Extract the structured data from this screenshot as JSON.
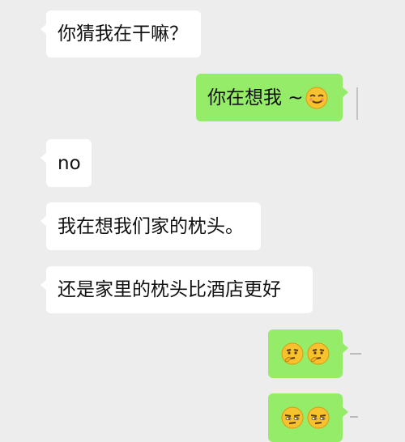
{
  "chat": {
    "messages": [
      {
        "side": "incoming",
        "text": "你猜我在干嘛？"
      },
      {
        "side": "outgoing",
        "text": "你在想我 ~",
        "emojis": [
          "smirk-face-emoji"
        ]
      },
      {
        "side": "incoming",
        "text": "no"
      },
      {
        "side": "incoming",
        "text": "我在想我们家的枕头。"
      },
      {
        "side": "incoming",
        "text": "还是家里的枕头比酒店更好"
      },
      {
        "side": "outgoing",
        "text": "",
        "emojis": [
          "thinking-face-emoji",
          "thinking-face-emoji"
        ]
      },
      {
        "side": "outgoing",
        "text": "",
        "emojis": [
          "skeptical-face-emoji",
          "skeptical-face-emoji"
        ]
      }
    ]
  },
  "colors": {
    "background": "#ededed",
    "incoming_bubble": "#ffffff",
    "outgoing_bubble": "#95ec69",
    "emoji_yellow": "#f7c22e"
  }
}
